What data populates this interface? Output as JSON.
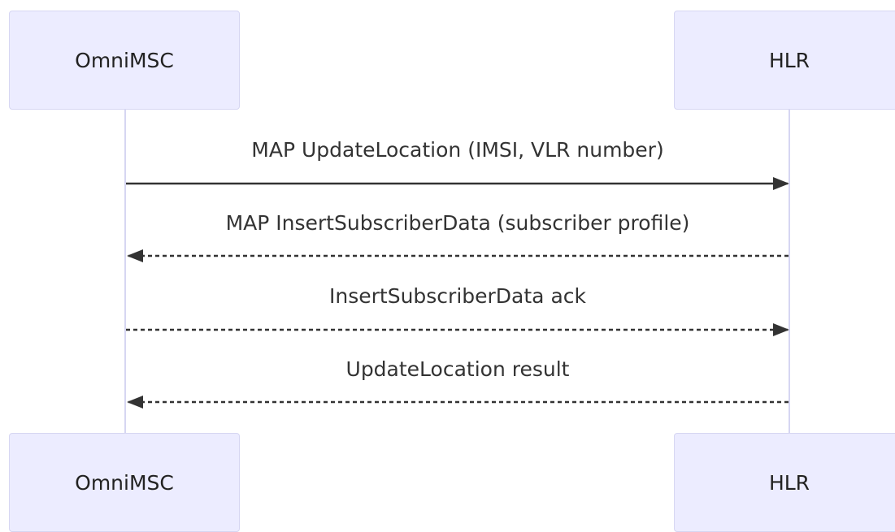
{
  "participants": [
    {
      "id": "omnimsc",
      "label": "OmniMSC"
    },
    {
      "id": "hlr",
      "label": "HLR"
    }
  ],
  "messages": [
    {
      "from": "omnimsc",
      "to": "hlr",
      "style": "solid",
      "label": "MAP UpdateLocation (IMSI, VLR number)"
    },
    {
      "from": "hlr",
      "to": "omnimsc",
      "style": "dashed",
      "label": "MAP InsertSubscriberData (subscriber profile)"
    },
    {
      "from": "omnimsc",
      "to": "hlr",
      "style": "dashed",
      "label": "InsertSubscriberData ack"
    },
    {
      "from": "hlr",
      "to": "omnimsc",
      "style": "dashed",
      "label": "UpdateLocation result"
    }
  ],
  "colors": {
    "actor_fill": "#ececff",
    "actor_border": "#d6d6f2",
    "lifeline": "#d6d6f2",
    "arrow": "#333333"
  }
}
